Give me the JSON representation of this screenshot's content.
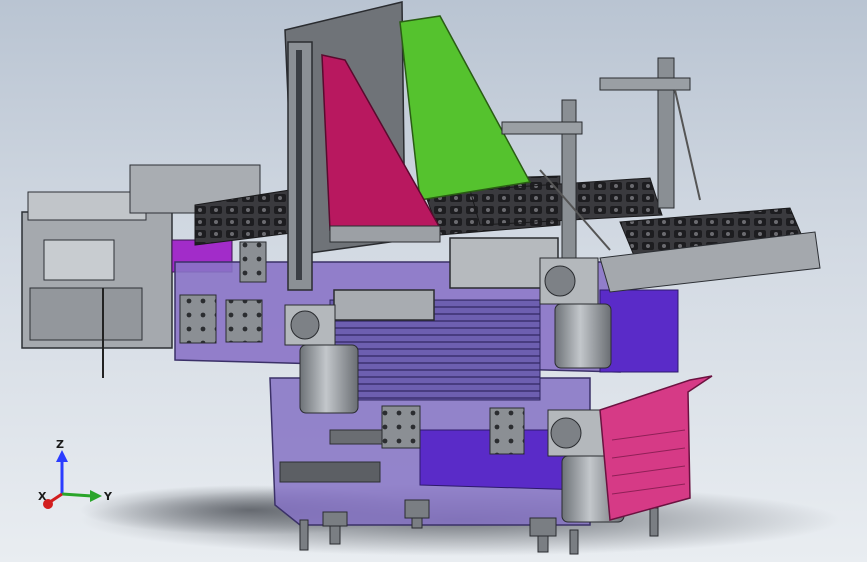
{
  "viewport": {
    "colors": {
      "background_top": "#b9c4d2",
      "background_bottom": "#e9edf1",
      "steel": "#8e9499",
      "steel_dark": "#3b3f44",
      "panel_magenta": "#b8185f",
      "panel_green": "#55c22e",
      "panel_purple": "#7a52c2",
      "panel_violet": "#5a2bc8",
      "panel_pink": "#d63a86",
      "tray_dark": "#3a3a3e"
    }
  },
  "triad": {
    "axis_z": "Z",
    "axis_y": "Y",
    "axis_x": "X",
    "colors": {
      "z": "#2b3cff",
      "y": "#2aa52a",
      "x": "#d21e1e"
    }
  }
}
